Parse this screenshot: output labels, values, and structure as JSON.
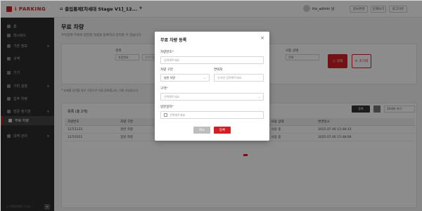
{
  "brand": {
    "name": "i PARKING"
  },
  "header": {
    "site_title": "출입통제[차세대 Stage V1]_12...",
    "user_name": "tta_admin 님",
    "buttons": [
      "정보변경",
      "문제보기",
      "로그아웃"
    ]
  },
  "sidebar": {
    "items": [
      {
        "label": "홈",
        "icon": "home-icon",
        "active": false,
        "chevron": false
      },
      {
        "label": "대시보드",
        "icon": "dashboard-icon",
        "active": false,
        "chevron": false
      },
      {
        "label": "기본 정보",
        "icon": "info-icon",
        "active": false,
        "chevron": true
      },
      {
        "label": "구역",
        "icon": "zone-icon",
        "active": false,
        "chevron": false
      },
      {
        "label": "기기",
        "icon": "device-icon",
        "active": false,
        "chevron": false
      },
      {
        "label": "기타 설정",
        "icon": "settings-icon",
        "active": false,
        "chevron": true
      },
      {
        "label": "입주 차량",
        "icon": "car-icon",
        "active": false,
        "chevron": false
      },
      {
        "label": "방문 정기권",
        "icon": "ticket-icon",
        "active": false,
        "chevron": true
      },
      {
        "label": "무료 차량",
        "icon": "free-car-icon",
        "active": true,
        "chevron": false
      },
      {
        "label": "내역 관리",
        "icon": "history-icon",
        "active": false,
        "chevron": true
      }
    ],
    "footer": "ⓒ IPARKING Corp.",
    "plus": "+"
  },
  "main": {
    "title": "무료 차량",
    "description": "주차장에 무료로 방문할 차량을 등록하고 관리할 수 있습니다.",
    "filter": {
      "search_label": "검색",
      "search_select": "차량번호",
      "search_placeholder": "검색어를 입력하세요",
      "status_label": "사용 상태",
      "status_value": "전체",
      "search_button": "검색",
      "reset_button": "초기화"
    },
    "note": "* 날짜를 입력할 경우 기준으로 자동 등록됩니다. 이용 가능합니다.",
    "list": {
      "title": "목록 (총 2개)",
      "register_button": "등록",
      "page_size": "20개씩 보기",
      "columns": [
        "차량번호",
        "차량 구분",
        "",
        "",
        "",
        "",
        "사용 상태",
        "변경일시"
      ],
      "rows": [
        [
          "12가1233",
          "일반 차량",
          "",
          "",
          "",
          "2025.07.06",
          "사용 중",
          "2025.07.06 15:48:33"
        ],
        [
          "12가3311",
          "일반 차량",
          "",
          "",
          "",
          "2025.07.06",
          "사용 중",
          "2025.07.06 15:48:06"
        ]
      ]
    }
  },
  "modal": {
    "title": "무료 차량 등록",
    "close": "×",
    "car_number_label": "차량번호",
    "car_number_placeholder": "입력해주세요",
    "car_type_label": "차량 구분",
    "car_type_value": "일반 차량",
    "contact_label": "연락처",
    "contact_placeholder": "숫자만 입력해주세요",
    "zone_label": "구역",
    "zone_placeholder": "선택해주세요",
    "period_label": "방문일자",
    "period_placeholder": "선택해주세요",
    "cancel_button": "취소",
    "ok_button": "등록"
  }
}
